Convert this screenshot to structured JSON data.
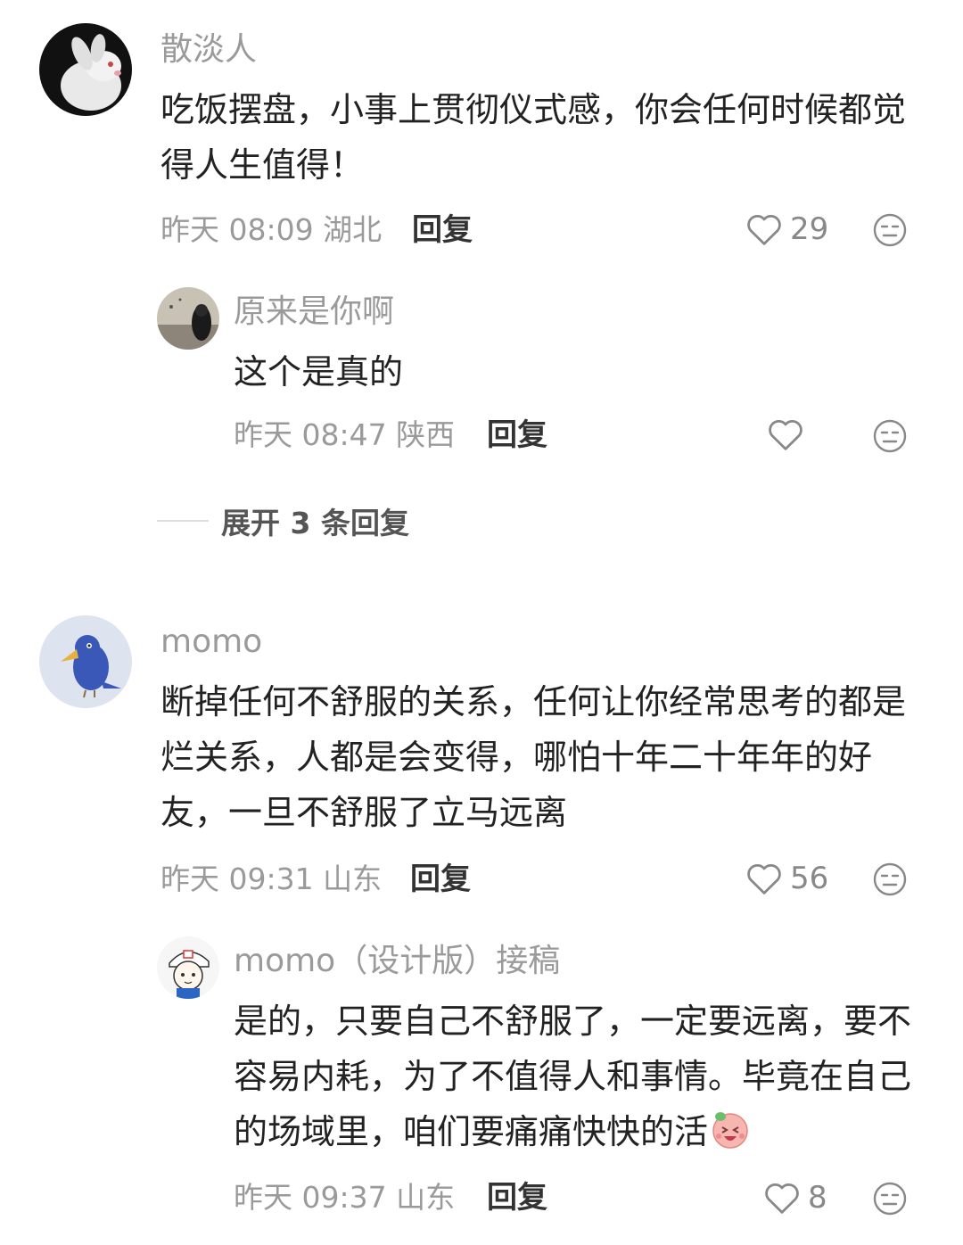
{
  "comments": [
    {
      "username": "散淡人",
      "text": "吃饭摆盘，小事上贯彻仪式感，你会任何时候都觉得人生值得！",
      "time": "昨天 08:09 湖北",
      "reply_label": "回复",
      "likes": "29",
      "avatar_icon": "white-rabbit-avatar"
    },
    {
      "username": "原来是你啊",
      "text": "这个是真的",
      "time": "昨天 08:47 陕西",
      "reply_label": "回复",
      "likes": "",
      "avatar_icon": "girl-seaside-avatar"
    },
    {
      "expand_label": "展开 3 条回复"
    },
    {
      "username": "momo",
      "text": "断掉任何不舒服的关系，任何让你经常思考的都是烂关系，人都是会变得，哪怕十年二十年年的好友，一旦不舒服了立马远离",
      "time": "昨天 09:31 山东",
      "reply_label": "回复",
      "likes": "56",
      "avatar_icon": "blue-bird-avatar"
    },
    {
      "username": "momo（设计版）接稿",
      "text": "是的，只要自己不舒服了，一定要远离，要不容易内耗，为了不值得人和事情。毕竟在自己的场域里，咱们要痛痛快快的活",
      "time": "昨天 09:37 山东",
      "reply_label": "回复",
      "likes": "8",
      "avatar_icon": "cartoon-boy-cap-avatar",
      "emoji": "laughing-pig-emoji"
    }
  ],
  "colors": {
    "meta": "#9a9a9a",
    "text": "#222222",
    "icon": "#888888"
  }
}
